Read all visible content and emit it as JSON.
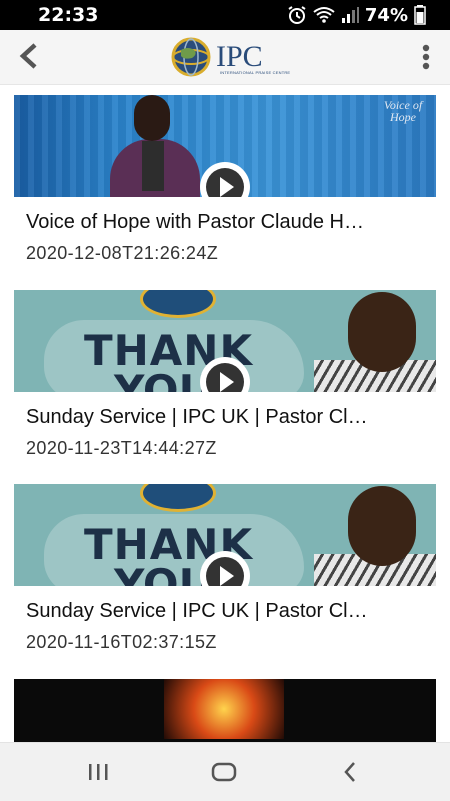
{
  "status_bar": {
    "time": "22:33",
    "battery": "74%",
    "icons": [
      "alarm-icon",
      "wifi-icon",
      "signal-icon",
      "battery-icon"
    ]
  },
  "app_bar": {
    "logo_text": "IPC",
    "logo_subtitle": "INTERNATIONAL PRAISE CENTRE",
    "back_icon": "back-arrow-icon",
    "menu_icon": "more-vert-icon"
  },
  "videos": [
    {
      "title": "Voice of Hope with Pastor Claude H…",
      "date": "2020-12-08T21:26:24Z",
      "thumb_brand": "Voice of Hope"
    },
    {
      "title": "Sunday Service | IPC UK | Pastor Cl…",
      "date": "2020-11-23T14:44:27Z",
      "thumb_text_1": "THANK",
      "thumb_text_2": "YOU"
    },
    {
      "title": "Sunday Service | IPC UK | Pastor Cl…",
      "date": "2020-11-16T02:37:15Z",
      "thumb_text_1": "THANK",
      "thumb_text_2": "YOU"
    }
  ],
  "nav": {
    "icons": [
      "recent-apps-icon",
      "home-icon",
      "back-icon"
    ]
  }
}
